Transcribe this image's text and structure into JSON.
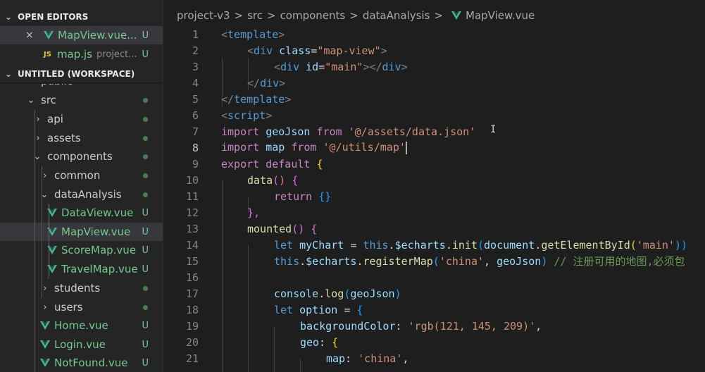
{
  "sidebar": {
    "open_editors_title": "OPEN EDITORS",
    "workspace_title": "UNTITLED (WORKSPACE)",
    "open_editors": [
      {
        "name": "MapView.vue...",
        "status": "U",
        "close": "×"
      },
      {
        "name": "map.js",
        "desc": "project...",
        "status": "U"
      }
    ],
    "tree": [
      {
        "label": "public"
      },
      {
        "label": "src"
      },
      {
        "label": "api"
      },
      {
        "label": "assets"
      },
      {
        "label": "components"
      },
      {
        "label": "common"
      },
      {
        "label": "dataAnalysis"
      },
      {
        "label": "DataView.vue",
        "status": "U"
      },
      {
        "label": "MapView.vue",
        "status": "U"
      },
      {
        "label": "ScoreMap.vue",
        "status": "U"
      },
      {
        "label": "TravelMap.vue",
        "status": "U"
      },
      {
        "label": "students"
      },
      {
        "label": "users"
      },
      {
        "label": "Home.vue",
        "status": "U"
      },
      {
        "label": "Login.vue",
        "status": "U"
      },
      {
        "label": "NotFound.vue",
        "status": "U"
      }
    ]
  },
  "breadcrumb": {
    "parts": [
      "project-v3",
      "src",
      "components",
      "dataAnalysis"
    ],
    "file": "MapView.vue",
    "separator": ">"
  },
  "editor": {
    "active_line": 8,
    "line_numbers": [
      "1",
      "2",
      "3",
      "4",
      "5",
      "6",
      "7",
      "8",
      "9",
      "10",
      "11",
      "12",
      "13",
      "14",
      "15",
      "16",
      "17",
      "18",
      "19",
      "20",
      "21"
    ],
    "lines": {
      "l1": [
        "<",
        "template",
        ">"
      ],
      "l2": [
        "<",
        "div",
        "class",
        "=",
        "\"map-view\"",
        ">"
      ],
      "l3": [
        "<",
        "div",
        "id",
        "=",
        "\"main\"",
        "></",
        "div",
        ">"
      ],
      "l4": [
        "</",
        "div",
        ">"
      ],
      "l5": [
        "</",
        "template",
        ">"
      ],
      "l6": [
        "<",
        "script",
        ">"
      ],
      "l7": [
        "import",
        "geoJson",
        "from",
        "'@/assets/data.json'"
      ],
      "l8": [
        "import",
        "map",
        "from",
        "'@/utils/map'"
      ],
      "l9": [
        "export",
        "default",
        "{"
      ],
      "l10": [
        "data",
        "()",
        "{"
      ],
      "l11": [
        "return",
        "{}"
      ],
      "l12": [
        "},"
      ],
      "l13": [
        "mounted",
        "()",
        "{"
      ],
      "l14": [
        "let",
        "myChart",
        "=",
        "this",
        ".",
        "$echarts",
        ".",
        "init",
        "(",
        "document",
        ".",
        "getElementById",
        "(",
        "'main'",
        "))"
      ],
      "l15": [
        "this",
        ".",
        "$echarts",
        ".",
        "registerMap",
        "(",
        "'china'",
        ",",
        "geoJson",
        ")",
        "// 注册可用的地图,必须包"
      ],
      "l17": [
        "console",
        ".",
        "log",
        "(",
        "geoJson",
        ")"
      ],
      "l18": [
        "let",
        "option",
        "=",
        "{"
      ],
      "l19": [
        "backgroundColor",
        ":",
        "'rgb(121, 145, 209)'",
        ","
      ],
      "l20": [
        "geo",
        ":",
        "{"
      ],
      "l21": [
        "map",
        ":",
        "'china'",
        ","
      ]
    }
  },
  "colors": {
    "vue_green": "#41b883",
    "vue_dark": "#35495e",
    "untracked": "#73c991"
  }
}
